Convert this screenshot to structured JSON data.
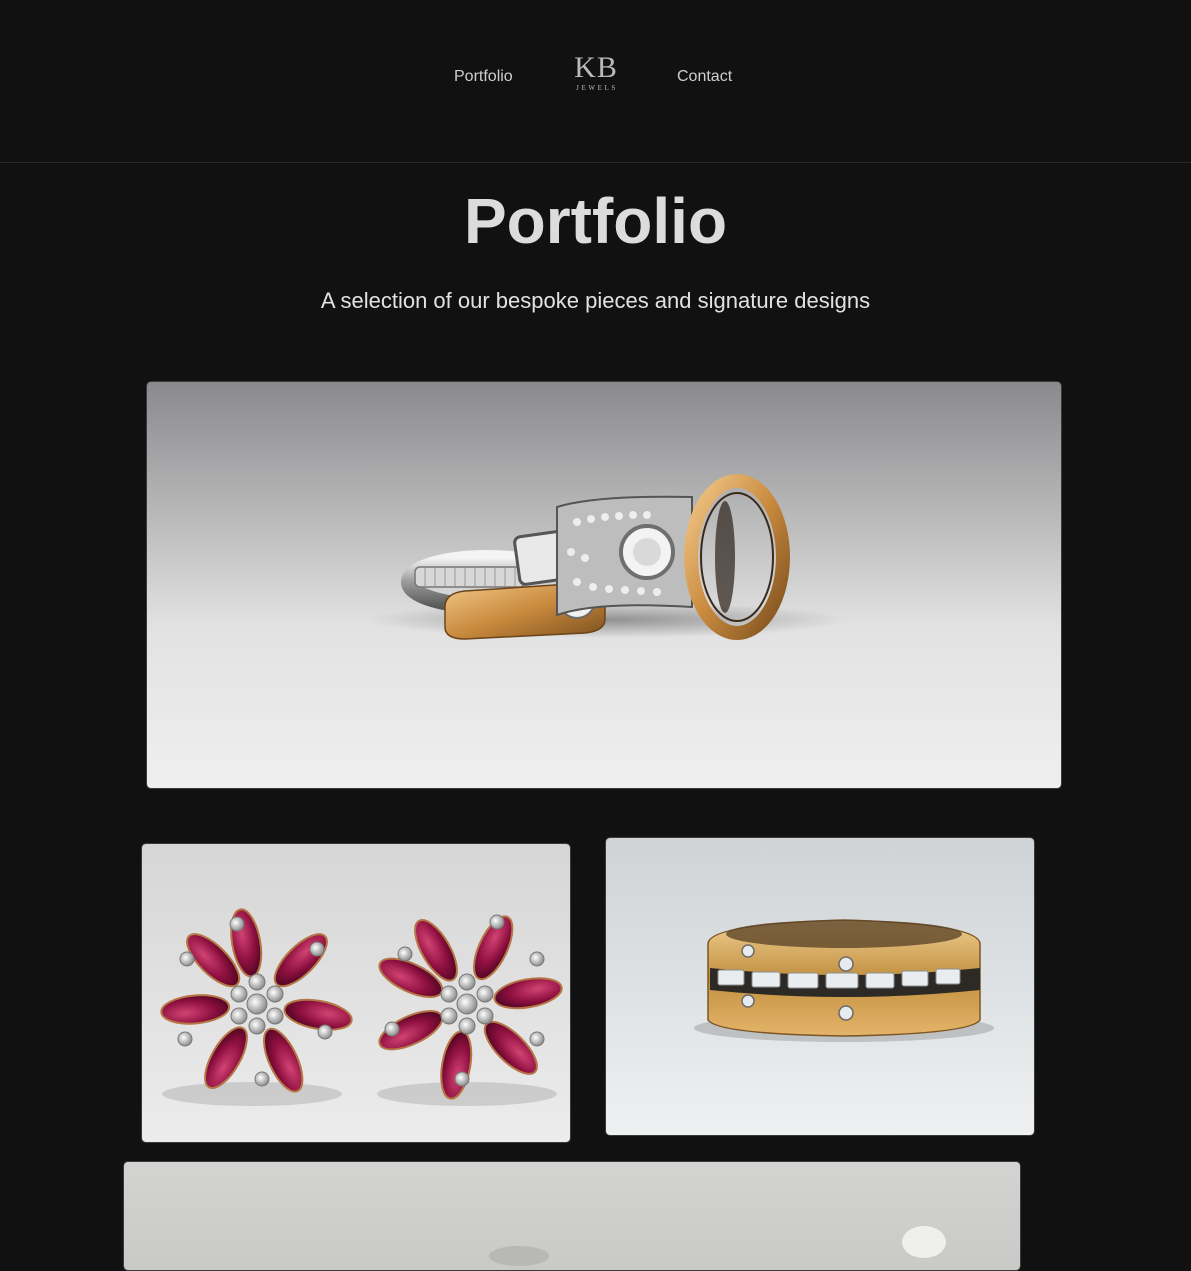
{
  "header": {
    "nav": {
      "portfolio_label": "Portfolio",
      "contact_label": "Contact"
    },
    "logo": {
      "mark": "KB",
      "subtitle": "JEWELS"
    }
  },
  "main": {
    "title": "Portfolio",
    "subtitle": "A selection of our bespoke pieces and signature designs",
    "gallery": [
      {
        "subject": "stack-of-rings-photo"
      },
      {
        "subject": "ruby-diamond-flower-earrings-photo"
      },
      {
        "subject": "gold-baguette-diamond-band-photo"
      },
      {
        "subject": "jewelry-photo-partially-visible"
      }
    ]
  },
  "colors": {
    "background": "#111111",
    "text": "#e6e6e6",
    "nav_text": "#cfcfcf",
    "logo": "#b9b9b9",
    "divider": "#2a2a2a"
  }
}
